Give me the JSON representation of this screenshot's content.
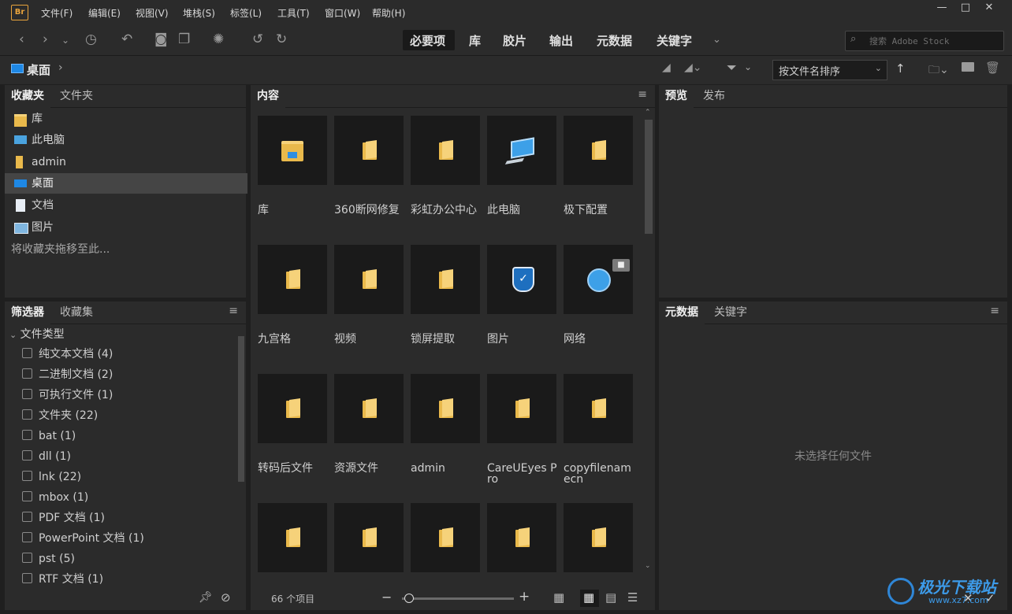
{
  "app": {
    "logo": "Br"
  },
  "menu": [
    "文件(F)",
    "编辑(E)",
    "视图(V)",
    "堆栈(S)",
    "标签(L)",
    "工具(T)",
    "窗口(W)",
    "帮助(H)"
  ],
  "window_controls": {
    "minimize": "—",
    "maximize": "□",
    "close": "✕"
  },
  "workspaces": [
    "必要项",
    "库",
    "胶片",
    "输出",
    "元数据",
    "关键字"
  ],
  "search": {
    "placeholder": "搜索 Adobe Stock"
  },
  "path": {
    "current": "桌面"
  },
  "sort": {
    "value": "按文件名排序"
  },
  "favorites_panel": {
    "tabs": [
      "收藏夹",
      "文件夹"
    ],
    "items": [
      {
        "label": "库",
        "icon": "library-folder-icon"
      },
      {
        "label": "此电脑",
        "icon": "computer-icon"
      },
      {
        "label": "admin",
        "icon": "folder-icon"
      },
      {
        "label": "桌面",
        "icon": "desktop-icon"
      },
      {
        "label": "文档",
        "icon": "document-icon"
      },
      {
        "label": "图片",
        "icon": "picture-icon"
      }
    ],
    "drop_hint": "将收藏夹拖移至此..."
  },
  "filter_panel": {
    "tabs": [
      "筛选器",
      "收藏集"
    ],
    "group": "文件类型",
    "items": [
      "纯文本文档 (4)",
      "二进制文档 (2)",
      "可执行文件 (1)",
      "文件夹 (22)",
      "bat (1)",
      "dll (1)",
      "lnk (22)",
      "mbox (1)",
      "PDF 文档 (1)",
      "PowerPoint 文档 (1)",
      "pst (5)",
      "RTF 文档 (1)"
    ]
  },
  "content_panel": {
    "tab": "内容",
    "tiles": [
      {
        "label": "库",
        "icon": "library-folder-icon"
      },
      {
        "label": "360断网修复",
        "icon": "folder-icon"
      },
      {
        "label": "彩虹办公中心",
        "icon": "folder-icon"
      },
      {
        "label": "此电脑",
        "icon": "computer-icon"
      },
      {
        "label": "极下配置",
        "icon": "folder-icon"
      },
      {
        "label": "九宫格",
        "icon": "folder-icon"
      },
      {
        "label": "视频",
        "icon": "folder-icon"
      },
      {
        "label": "锁屏提取",
        "icon": "folder-icon"
      },
      {
        "label": "图片",
        "icon": "shield-icon"
      },
      {
        "label": "网络",
        "icon": "network-icon"
      },
      {
        "label": "转码后文件",
        "icon": "folder-icon"
      },
      {
        "label": "资源文件",
        "icon": "folder-icon"
      },
      {
        "label": "admin",
        "icon": "folder-icon"
      },
      {
        "label": "CareUEyes Pro",
        "icon": "folder-icon"
      },
      {
        "label": "copyfilenamecn",
        "icon": "folder-icon"
      },
      {
        "label": "",
        "icon": "folder-icon"
      },
      {
        "label": "",
        "icon": "folder-icon"
      },
      {
        "label": "",
        "icon": "folder-icon"
      },
      {
        "label": "",
        "icon": "folder-icon"
      },
      {
        "label": "",
        "icon": "folder-icon"
      }
    ],
    "item_count": "66 个项目"
  },
  "preview_panel": {
    "tabs": [
      "预览",
      "发布"
    ]
  },
  "metadata_panel": {
    "tabs": [
      "元数据",
      "关键字"
    ],
    "empty_text": "未选择任何文件"
  },
  "watermark": {
    "text": "极光下载站",
    "url": "www.xz7.com"
  },
  "colors": {
    "accent": "#e8a33c",
    "folder": "#e9b94b",
    "bg": "#1f1f1f",
    "panel": "#2b2b2b"
  }
}
